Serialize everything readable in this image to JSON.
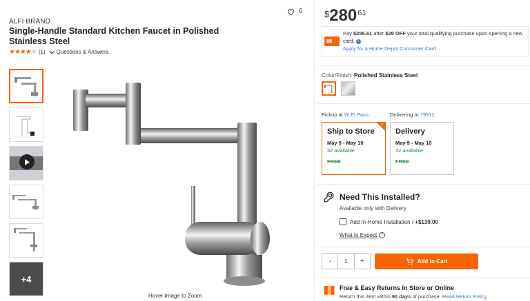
{
  "product": {
    "brand": "ALFI BRAND",
    "title": "Single-Handle Standard Kitchen Faucet in Polished Stainless Steel",
    "favorites_count": "6",
    "rating_value": 4,
    "rating_count": "(1)",
    "qa_label": "Questions & Answers",
    "more_images_label": "+4",
    "hover_hint": "Hover Image to Zoom"
  },
  "price": {
    "symbol": "$",
    "dollars": "280",
    "cents": "61"
  },
  "promo": {
    "pay_text": "Pay ",
    "pay_amount": "$255.61",
    "after_text": " after ",
    "discount": "$25 OFF",
    "rest_text": " your total qualifying purchase upon opening a new card.",
    "apply_link": "Apply for a Home Depot Consumer Card"
  },
  "color": {
    "label": "Color/Finish:",
    "value": "Polished Stainless Steel"
  },
  "fulfillment": {
    "pickup_prefix": "Pickup at ",
    "pickup_store": "W El Paso",
    "delivery_prefix": "Delivering to ",
    "delivery_zip": "79912",
    "ship": {
      "title": "Ship to Store",
      "dates": "May 9 - May 10",
      "available": "32 available",
      "cost": "FREE"
    },
    "delivery": {
      "title": "Delivery",
      "dates": "May 9 - May 10",
      "available": "32 available",
      "cost": "FREE"
    }
  },
  "install": {
    "title": "Need This Installed?",
    "subtitle": "Available only with Delivery",
    "option_label": "Add In-Home Installation / ",
    "option_price": "+$139.00",
    "what_to_expect": "What to Expect"
  },
  "cart": {
    "minus": "-",
    "quantity": "1",
    "plus": "+",
    "add_label": "Add to Cart"
  },
  "returns": {
    "title": "Free & Easy Returns In Store or Online",
    "text_prefix": "Return this item within ",
    "days": "90 days",
    "text_suffix": " of purchase. ",
    "policy_link": "Read Return Policy"
  },
  "colors": {
    "accent": "#f96302",
    "link": "#3e7ac8",
    "available": "#1f8a3e"
  }
}
